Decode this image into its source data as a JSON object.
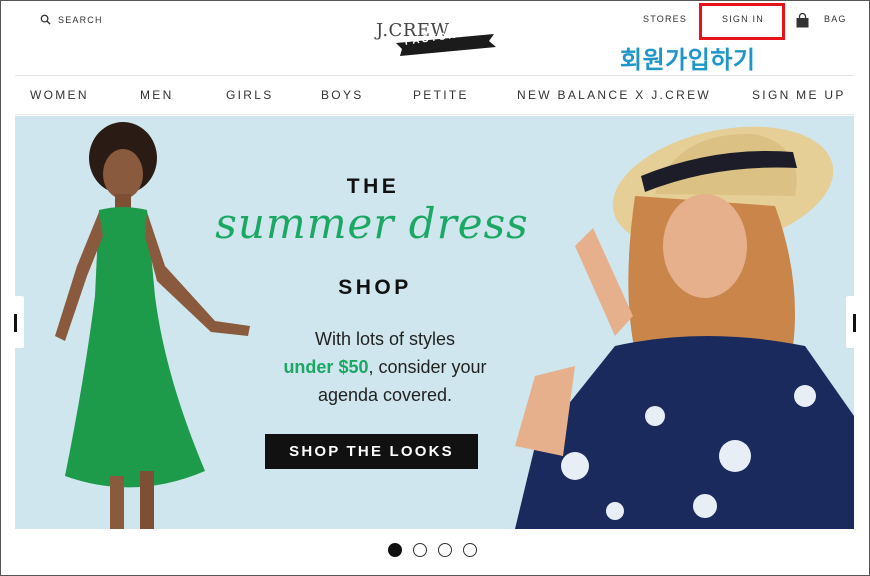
{
  "header": {
    "search_label": "SEARCH",
    "logo_top": "J.CREW",
    "logo_bottom": "FACTORY",
    "stores_label": "STORES",
    "signin_label": "SIGN IN",
    "bag_label": "BAG",
    "annotation": "회원가입하기"
  },
  "nav": {
    "items": [
      {
        "label": "WOMEN"
      },
      {
        "label": "MEN"
      },
      {
        "label": "GIRLS"
      },
      {
        "label": "BOYS"
      },
      {
        "label": "PETITE"
      },
      {
        "label": "NEW BALANCE X J.CREW"
      },
      {
        "label": "SIGN ME UP"
      }
    ]
  },
  "hero": {
    "the": "THE",
    "script": "summer dress",
    "shop": "SHOP",
    "copy_line1": "With lots of styles",
    "copy_green": "under $50",
    "copy_line2_rest": ", consider your",
    "copy_line3": "agenda covered.",
    "cta": "SHOP THE LOOKS"
  },
  "carousel": {
    "total": 4,
    "active_index": 0
  },
  "colors": {
    "accent_green": "#1aa864",
    "hero_bg": "#cfe6ee",
    "highlight_red": "#e8121a",
    "annotation_blue": "#1f96c9"
  }
}
